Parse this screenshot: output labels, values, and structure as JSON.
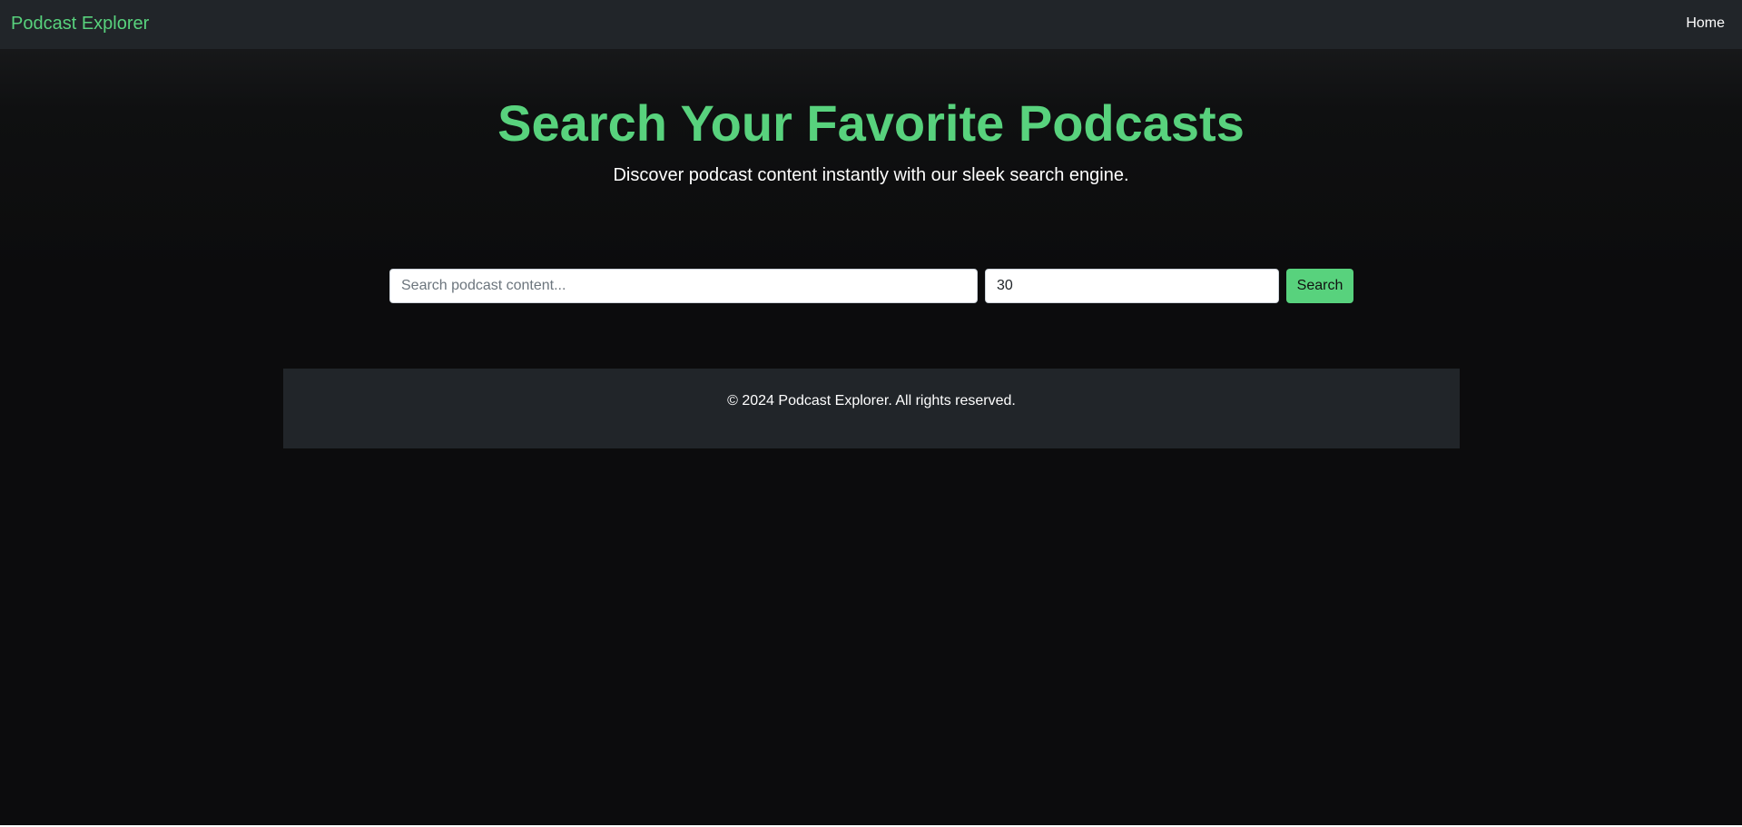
{
  "navbar": {
    "brand": "Podcast Explorer",
    "links": [
      "Home"
    ]
  },
  "hero": {
    "title": "Search Your Favorite Podcasts",
    "subtitle": "Discover podcast content instantly with our sleek search engine."
  },
  "search": {
    "query_value": "",
    "query_placeholder": "Search podcast content...",
    "limit_value": "30",
    "button_label": "Search"
  },
  "footer": {
    "text": "© 2024 Podcast Explorer. All rights reserved."
  },
  "colors": {
    "accent": "#58d27d",
    "navbar_bg": "#212529",
    "page_bg": "#0c0c0d",
    "text": "#ffffff"
  }
}
